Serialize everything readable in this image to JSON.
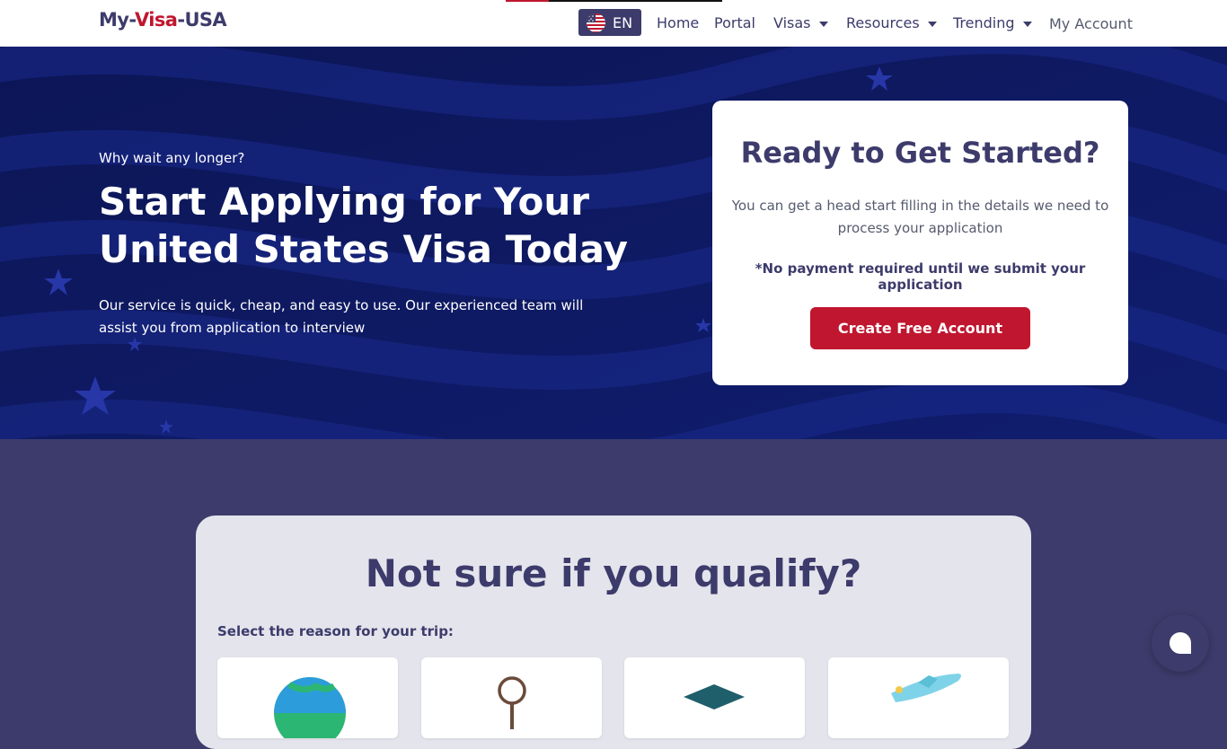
{
  "header": {
    "logo": {
      "part1": "My-",
      "part2": "Visa",
      "part3": "-USA"
    },
    "language": {
      "code": "EN",
      "flag_icon": "us-flag-icon"
    },
    "nav": {
      "home": "Home",
      "portal": "Portal",
      "visas": "Visas",
      "resources": "Resources",
      "trending": "Trending",
      "account": "My Account"
    }
  },
  "hero": {
    "eyebrow": "Why wait any longer?",
    "title": "Start Applying for Your United States Visa Today",
    "description": "Our service is quick, cheap, and easy to use. Our experienced team will assist you from application to interview"
  },
  "cta_card": {
    "title": "Ready to Get Started?",
    "text": "You can get a head start filling in the details we need to process your application",
    "note": "*No payment required until we submit your application",
    "button": "Create Free Account"
  },
  "qualify": {
    "title": "Not sure if you qualify?",
    "label": "Select the reason for your trip:",
    "cards": [
      {
        "icon": "globe-icon"
      },
      {
        "icon": "magnifier-icon"
      },
      {
        "icon": "graduation-cap-icon"
      },
      {
        "icon": "airplane-icon"
      }
    ]
  },
  "chat": {
    "icon": "chat-bubble-icon"
  },
  "colors": {
    "brand_navy": "#3c3b6b",
    "brand_red": "#c0162f",
    "hero_blue": "#0e1a5e",
    "white": "#ffffff"
  }
}
